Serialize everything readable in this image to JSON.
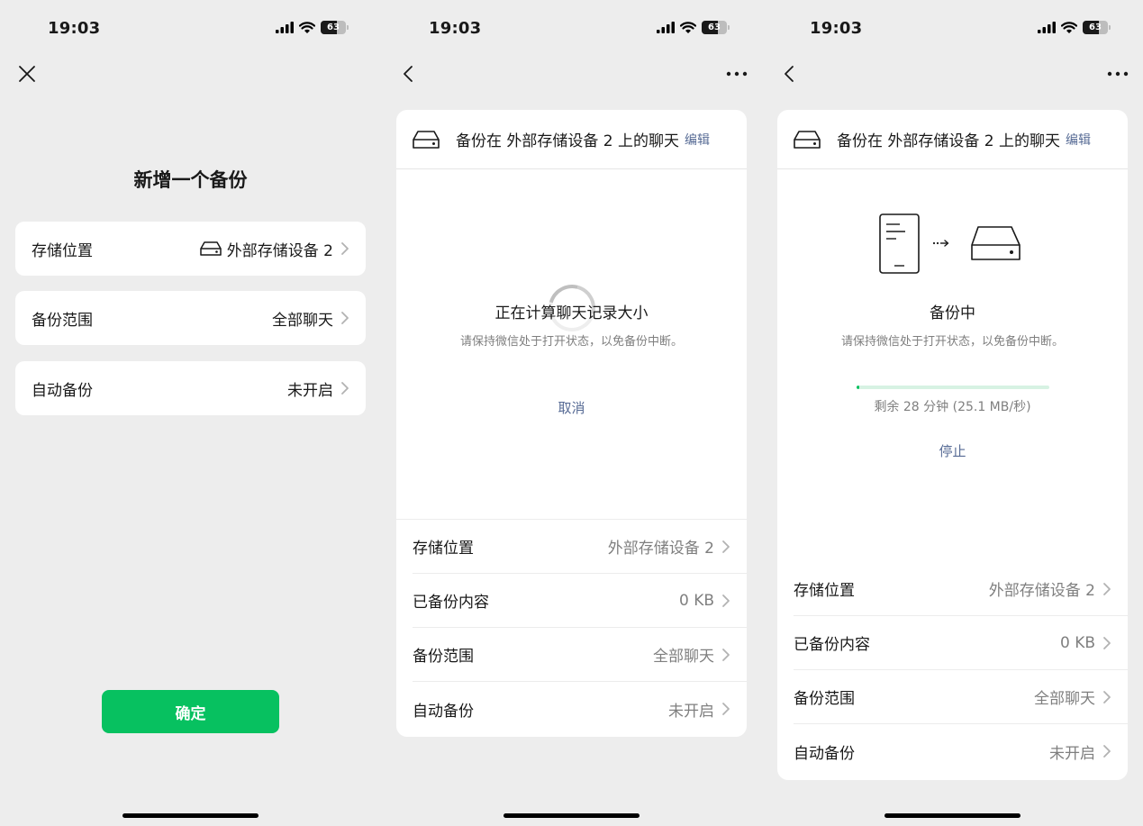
{
  "status_bar": {
    "time": "19:03",
    "battery": "63",
    "battery_level": 0.63
  },
  "screen1": {
    "title": "新增一个备份",
    "rows": [
      {
        "label": "存储位置",
        "value": "外部存储设备 2",
        "icon": "hard-drive-icon"
      },
      {
        "label": "备份范围",
        "value": "全部聊天"
      },
      {
        "label": "自动备份",
        "value": "未开启"
      }
    ],
    "confirm_label": "确定"
  },
  "screen2": {
    "card_title": "备份在 外部存储设备 2 上的聊天",
    "edit_label": "编辑",
    "status_title": "正在计算聊天记录大小",
    "status_sub": "请保持微信处于打开状态，以免备份中断。",
    "cancel_label": "取消",
    "rows": [
      {
        "label": "存储位置",
        "value": "外部存储设备 2"
      },
      {
        "label": "已备份内容",
        "value": "0 KB"
      },
      {
        "label": "备份范围",
        "value": "全部聊天"
      },
      {
        "label": "自动备份",
        "value": "未开启"
      }
    ]
  },
  "screen3": {
    "card_title": "备份在 外部存储设备 2 上的聊天",
    "edit_label": "编辑",
    "status_title": "备份中",
    "status_sub": "请保持微信处于打开状态，以免备份中断。",
    "progress_fraction": 0.01,
    "remaining": "剩余 28 分钟 (25.1 MB/秒)",
    "stop_label": "停止",
    "rows": [
      {
        "label": "存储位置",
        "value": "外部存储设备 2"
      },
      {
        "label": "已备份内容",
        "value": "0 KB"
      },
      {
        "label": "备份范围",
        "value": "全部聊天"
      },
      {
        "label": "自动备份",
        "value": "未开启"
      }
    ]
  },
  "colors": {
    "accent": "#07c160",
    "link": "#576b95",
    "background": "#ededed"
  }
}
